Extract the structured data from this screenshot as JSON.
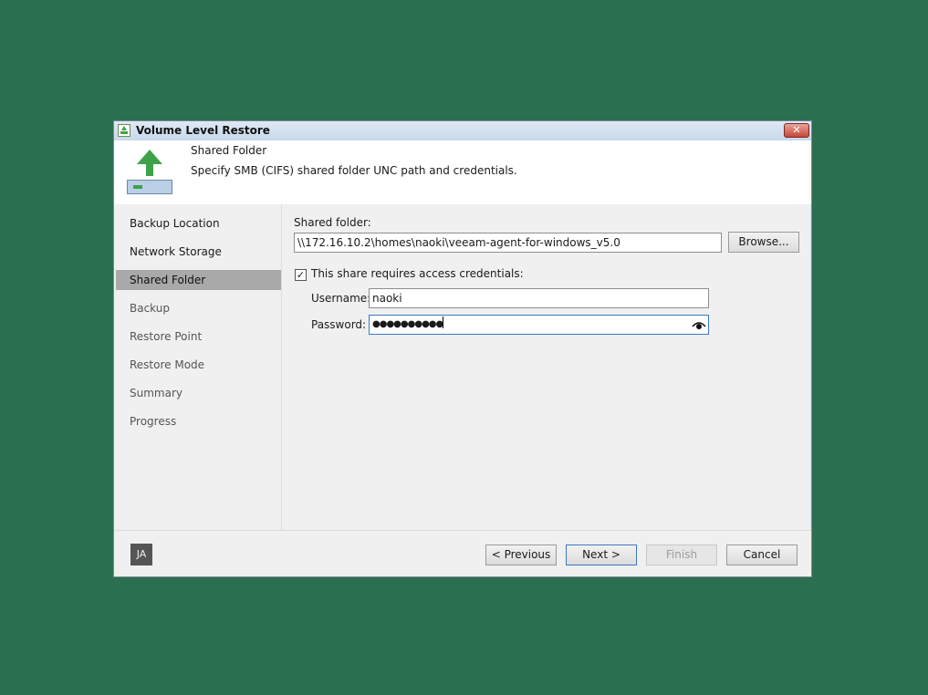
{
  "window": {
    "title": "Volume Level Restore",
    "close_label": "✕"
  },
  "header": {
    "title": "Shared Folder",
    "description": "Specify SMB (CIFS) shared folder UNC path and credentials."
  },
  "nav": {
    "items": [
      {
        "label": "Backup Location"
      },
      {
        "label": "Network Storage"
      },
      {
        "label": "Shared Folder"
      },
      {
        "label": "Backup"
      },
      {
        "label": "Restore Point"
      },
      {
        "label": "Restore Mode"
      },
      {
        "label": "Summary"
      },
      {
        "label": "Progress"
      }
    ],
    "selected": "Shared Folder"
  },
  "form": {
    "shared_folder_label": "Shared folder:",
    "shared_folder_value": "\\\\172.16.10.2\\homes\\naoki\\veeam-agent-for-windows_v5.0",
    "browse_label": "Browse...",
    "credentials_checkbox_label": "This share requires access credentials:",
    "credentials_checked": true,
    "username_label": "Username:",
    "username_value": "naoki",
    "password_label": "Password:",
    "password_masked": "●●●●●●●●●●"
  },
  "footer": {
    "avatar_initials": "JA",
    "previous_label": "< Previous",
    "next_label": "Next >",
    "finish_label": "Finish",
    "cancel_label": "Cancel"
  },
  "colors": {
    "desktop": "#2c6e50",
    "accent_green": "#3ea24a",
    "selected_nav": "#a9a9a9",
    "focus_border": "#3a78c6"
  }
}
